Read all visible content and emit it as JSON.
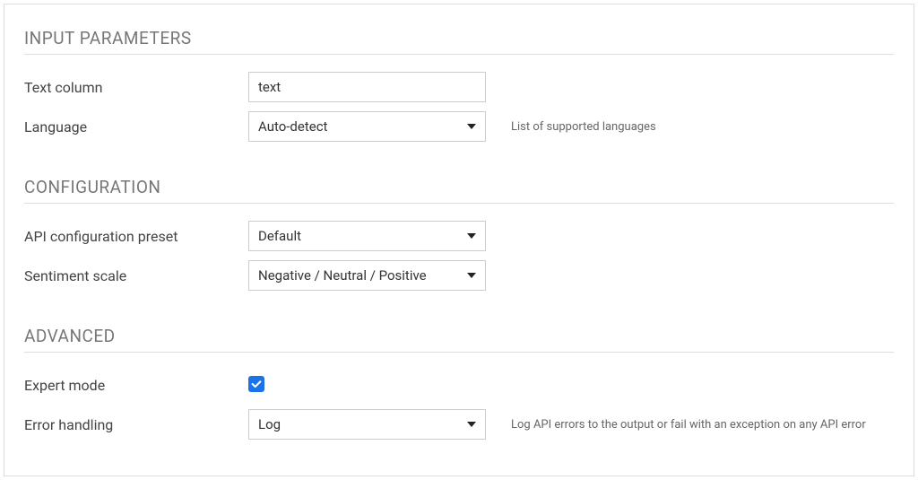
{
  "sections": {
    "input": {
      "heading": "INPUT PARAMETERS",
      "text_column": {
        "label": "Text column",
        "value": "text"
      },
      "language": {
        "label": "Language",
        "value": "Auto-detect",
        "help": "List of supported languages"
      }
    },
    "config": {
      "heading": "CONFIGURATION",
      "preset": {
        "label": "API configuration preset",
        "value": "Default"
      },
      "scale": {
        "label": "Sentiment scale",
        "value": "Negative / Neutral / Positive"
      }
    },
    "advanced": {
      "heading": "ADVANCED",
      "expert": {
        "label": "Expert mode",
        "checked": true
      },
      "error_handling": {
        "label": "Error handling",
        "value": "Log",
        "help": "Log API errors to the output or fail with an exception on any API error"
      }
    }
  }
}
